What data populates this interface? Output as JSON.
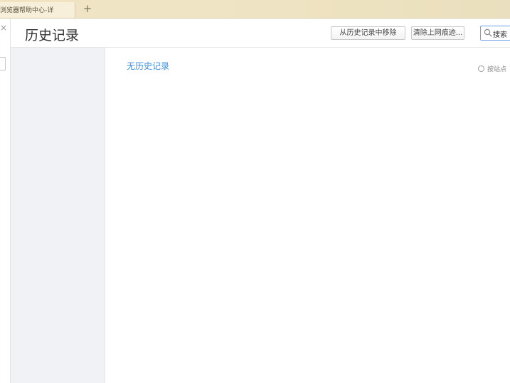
{
  "tab": {
    "title": "浏览器帮助中心-详",
    "new_tab_symbol": "+"
  },
  "left_panel": {
    "close_symbol": "×"
  },
  "header": {
    "title": "历史记录",
    "remove_button_label": "从历史记录中移除",
    "clear_button_label": "清除上网痕迹...",
    "search_text": "搜索"
  },
  "main": {
    "empty_message": "无历史记录",
    "sort_option_label": "按站点"
  },
  "icons": {
    "search": "search-icon",
    "close": "close-icon",
    "add": "plus-icon"
  },
  "colors": {
    "accent": "#3a8ee6",
    "tabstrip_bg": "#efe3c2",
    "sidebar_bg": "#f1f2f6"
  }
}
